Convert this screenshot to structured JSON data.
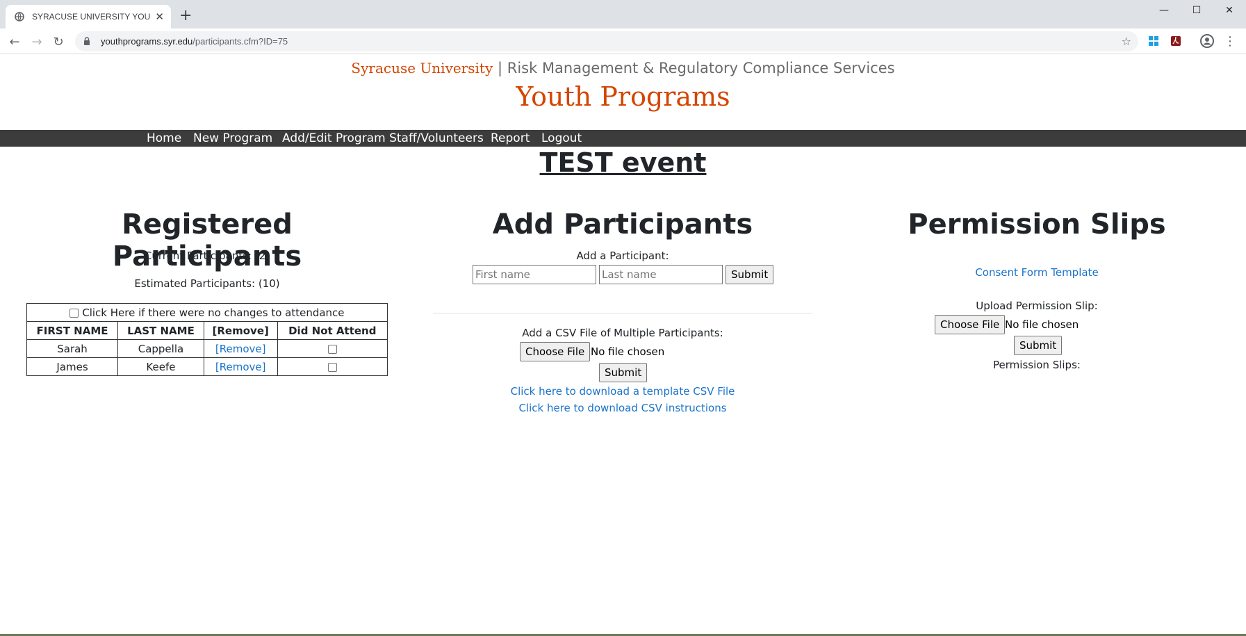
{
  "browser": {
    "tab_title": "SYRACUSE UNIVERSITY YOUTH P",
    "url_host": "youthprograms.syr.edu",
    "url_path": "/participants.cfm?ID=75"
  },
  "header": {
    "university": "Syracuse University",
    "separator": "|",
    "department": "Risk Management & Regulatory Compliance Services",
    "site_title": "Youth Programs"
  },
  "nav": {
    "items": [
      "Home",
      "New Program",
      "Add/Edit Program Staff/Volunteers",
      "Report",
      "Logout"
    ]
  },
  "event_title": "TEST event",
  "registered": {
    "heading": "Registered Participants",
    "current": "Current Participants: (2)",
    "estimated": "Estimated Participants: (10)",
    "no_changes_label": "Click Here if there were no changes to attendance",
    "columns": [
      "FIRST NAME",
      "LAST NAME",
      "[Remove]",
      "Did Not Attend"
    ],
    "rows": [
      {
        "first": "Sarah",
        "last": "Cappella",
        "remove": "[Remove]"
      },
      {
        "first": "James",
        "last": "Keefe",
        "remove": "[Remove]"
      }
    ]
  },
  "add": {
    "heading": "Add Participants",
    "add_label": "Add a Participant:",
    "first_placeholder": "First name",
    "last_placeholder": "Last name",
    "submit": "Submit",
    "csv_label": "Add a CSV File of Multiple Participants:",
    "choose_file": "Choose File",
    "no_file": "No file chosen",
    "csv_submit": "Submit",
    "template_link": "Click here to download a template CSV File",
    "instructions_link": "Click here to download CSV instructions"
  },
  "permission": {
    "heading": "Permission Slips",
    "consent_link": "Consent Form Template",
    "upload_label": "Upload Permission Slip:",
    "choose_file": "Choose File",
    "no_file": "No file chosen",
    "submit": "Submit",
    "slips_label": "Permission Slips:"
  },
  "icons": {
    "favicon": "globe-icon",
    "back": "back-arrow-icon",
    "forward": "forward-arrow-icon",
    "reload": "reload-icon",
    "lock": "lock-icon",
    "star": "star-icon",
    "windows_ext": "windows-icon",
    "pdf_ext": "adobe-pdf-icon",
    "profile": "profile-icon",
    "menu": "kebab-menu-icon"
  },
  "colors": {
    "brand_orange": "#d44500",
    "navbar_bg": "#3c3c3c",
    "link": "#1a73c9"
  }
}
